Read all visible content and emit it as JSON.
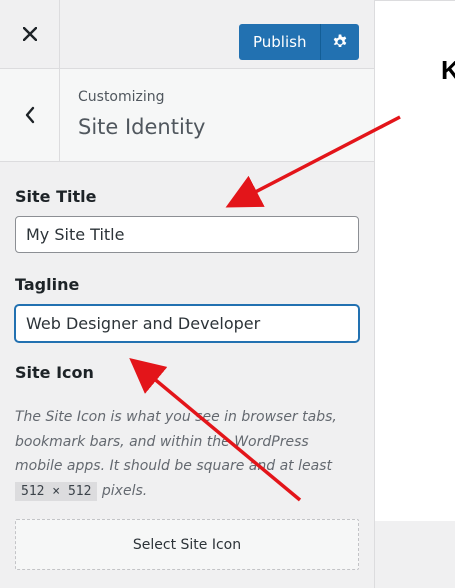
{
  "header": {
    "close_icon": "close-icon",
    "publish_label": "Publish",
    "settings_icon": "gear-icon"
  },
  "section": {
    "back_icon": "chevron-left-icon",
    "breadcrumb": "Customizing",
    "title": "Site Identity"
  },
  "site_title": {
    "label": "Site Title",
    "value": "My Site Title"
  },
  "tagline": {
    "label": "Tagline",
    "value": "Web Designer and Developer"
  },
  "site_icon": {
    "label": "Site Icon",
    "description_part1": "The Site Icon is what you see in browser tabs, bookmark bars, and within the WordPress mobile apps. It should be square and at least ",
    "size_code": "512 × 512",
    "description_part2": " pixels.",
    "button_label": "Select Site Icon"
  },
  "preview": {
    "visible_text": "K"
  },
  "colors": {
    "accent": "#2271b1",
    "panel_bg": "#f0f0f1",
    "annotation_arrow": "#e3151a"
  }
}
